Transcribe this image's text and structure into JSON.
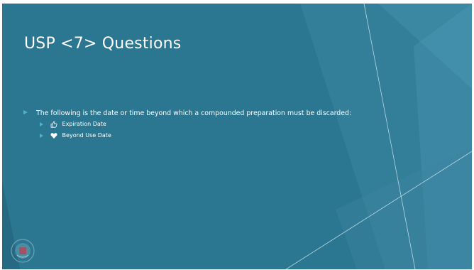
{
  "slide": {
    "title": "USP <7> Questions",
    "question": "The following is the date or time beyond which a compounded preparation must be discarded:",
    "options": [
      {
        "icon": "thumbs-up-icon",
        "label": "Expiration Date"
      },
      {
        "icon": "heart-icon",
        "label": "Beyond Use Date"
      }
    ]
  },
  "colors": {
    "background": "#2b7690",
    "accent": "#4fb3cf",
    "text": "#ffffff"
  }
}
